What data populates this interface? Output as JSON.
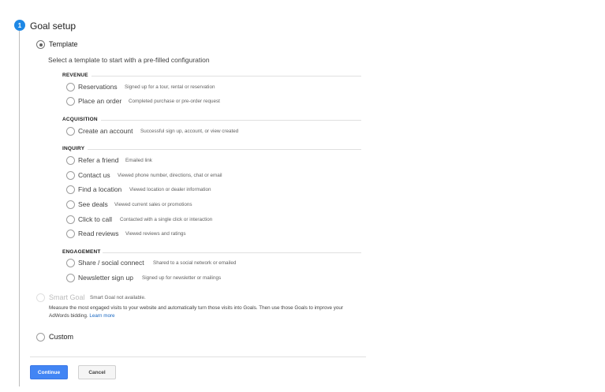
{
  "step": {
    "number": "1",
    "title": "Goal setup"
  },
  "options": {
    "template": {
      "label": "Template",
      "selected": true,
      "subtitle": "Select a template to start with a pre-filled configuration"
    },
    "smart_goal": {
      "label": "Smart Goal",
      "note": "Smart Goal not available.",
      "description": "Measure the most engaged visits to your website and automatically turn those visits into Goals. Then use those Goals to improve your AdWords bidding.",
      "link": "Learn more",
      "disabled": true
    },
    "custom": {
      "label": "Custom",
      "selected": false
    }
  },
  "sections": [
    {
      "title": "REVENUE",
      "items": [
        {
          "label": "Reservations",
          "desc": "Signed up for a tour, rental or reservation"
        },
        {
          "label": "Place an order",
          "desc": "Completed purchase or pre-order request"
        }
      ]
    },
    {
      "title": "ACQUISITION",
      "items": [
        {
          "label": "Create an account",
          "desc": "Successful sign up, account, or view created"
        }
      ]
    },
    {
      "title": "INQUIRY",
      "items": [
        {
          "label": "Refer a friend",
          "desc": "Emailed link"
        },
        {
          "label": "Contact us",
          "desc": "Viewed phone number, directions, chat or email"
        },
        {
          "label": "Find a location",
          "desc": "Viewed location or dealer information"
        },
        {
          "label": "See deals",
          "desc": "Viewed current sales or promotions"
        },
        {
          "label": "Click to call",
          "desc": "Contacted with a single click or interaction"
        },
        {
          "label": "Read reviews",
          "desc": "Viewed reviews and ratings"
        }
      ]
    },
    {
      "title": "ENGAGEMENT",
      "items": [
        {
          "label": "Share / social connect",
          "desc": "Shared to a social network or emailed"
        },
        {
          "label": "Newsletter sign up",
          "desc": "Signed up for newsletter or mailings"
        }
      ]
    }
  ],
  "buttons": {
    "continue": "Continue",
    "cancel": "Cancel"
  },
  "colors": {
    "accent": "#1e88e5",
    "primary_button": "#4285f4",
    "link": "#1565c0"
  }
}
